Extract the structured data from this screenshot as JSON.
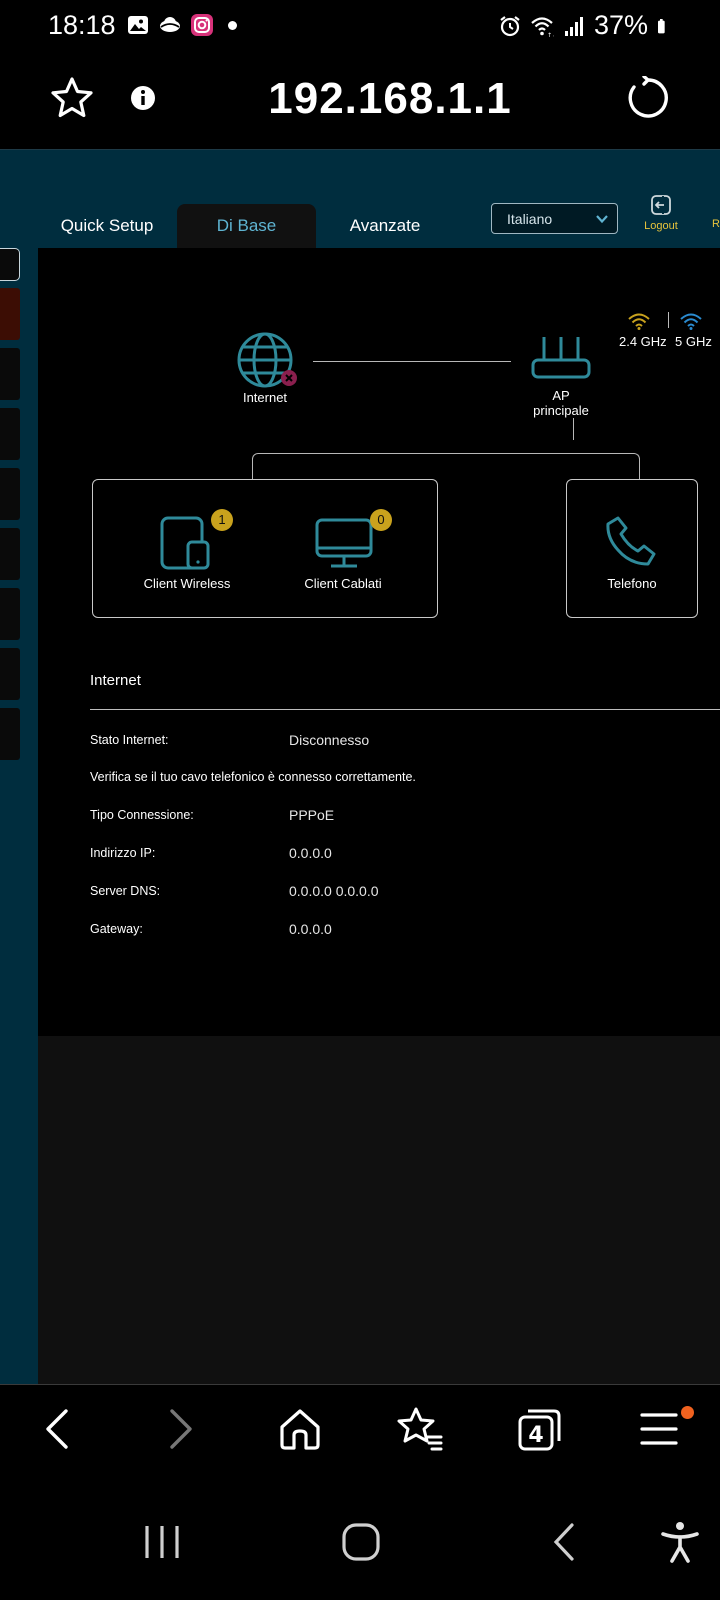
{
  "status_bar": {
    "time": "18:18",
    "battery_percent": "37%",
    "icons_left": [
      "gallery-icon",
      "cloud-icon",
      "instagram-icon",
      "notification-dot"
    ],
    "icons_right": [
      "alarm-icon",
      "wifi-icon",
      "signal-icon",
      "battery-icon"
    ]
  },
  "browser": {
    "url": "192.168.1.1",
    "tab_count": "4",
    "menu_notification_color": "#f0621f"
  },
  "router": {
    "tabs": [
      {
        "label": "Quick Setup",
        "active": false
      },
      {
        "label": "Di Base",
        "active": true
      },
      {
        "label": "Avanzate",
        "active": false
      }
    ],
    "language": "Italiano",
    "logout_label": "Logout",
    "cut_off_label": "R",
    "accent_color": "#5fb4d2",
    "yellow_color": "#e6c33c",
    "topology": {
      "internet_label": "Internet",
      "internet_status": "disconnected",
      "ap_label_line1": "AP",
      "ap_label_line2": "principale",
      "band_24": "2.4 GHz",
      "band_5": "5 GHz",
      "wireless_label": "Client Wireless",
      "wireless_count": "1",
      "wired_label": "Client Cablati",
      "wired_count": "0",
      "phone_label": "Telefono"
    },
    "internet_section": {
      "title": "Internet",
      "rows": [
        {
          "label": "Stato Internet:",
          "value": "Disconnesso"
        },
        {
          "label": "Tipo Connessione:",
          "value": "PPPoE"
        },
        {
          "label": "Indirizzo IP:",
          "value": "0.0.0.0"
        },
        {
          "label": "Server DNS:",
          "value": "0.0.0.0 0.0.0.0"
        },
        {
          "label": "Gateway:",
          "value": "0.0.0.0"
        }
      ],
      "note": "Verifica se il tuo cavo telefonico è connesso correttamente."
    }
  }
}
